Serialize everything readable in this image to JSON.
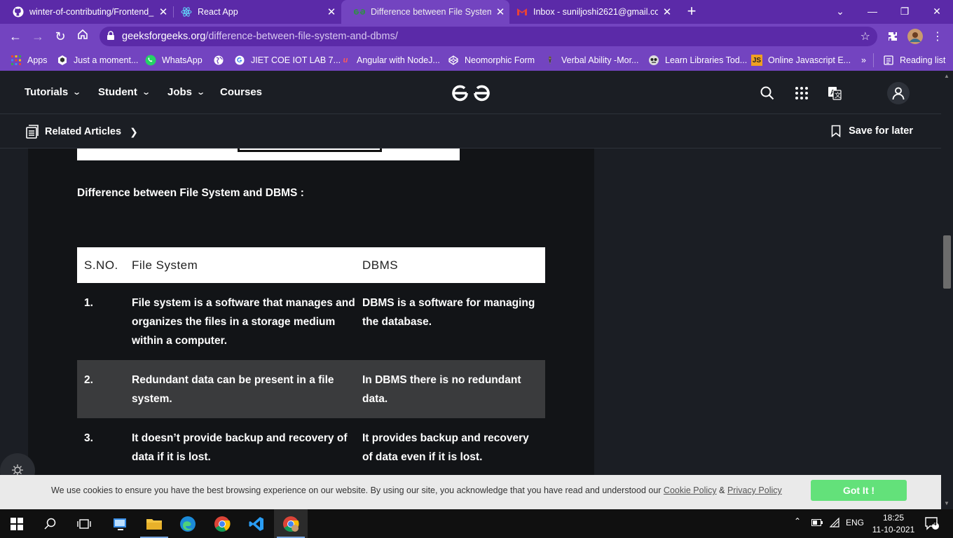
{
  "browser": {
    "tabs": [
      {
        "title": "winter-of-contributing/Frontend_",
        "icon": "github-icon"
      },
      {
        "title": "React App",
        "icon": "react-icon"
      },
      {
        "title": "Difference between File System a",
        "icon": "gfg-icon",
        "active": true
      },
      {
        "title": "Inbox - suniljoshi2621@gmail.co",
        "icon": "gmail-icon"
      }
    ],
    "url_domain": "geeksforgeeks.org",
    "url_path": "/difference-between-file-system-and-dbms/",
    "bookmarks": [
      "Apps",
      "Just a moment...",
      "WhatsApp",
      "",
      "JIET COE IOT LAB 7...",
      "Angular with NodeJ...",
      "Neomorphic Form",
      "Verbal Ability -Mor...",
      "Learn Libraries Tod...",
      "Online Javascript E..."
    ],
    "bookmarks_overflow": "»",
    "reading_list": "Reading list"
  },
  "site": {
    "nav": [
      "Tutorials",
      "Student",
      "Jobs",
      "Courses"
    ],
    "related_articles": "Related Articles",
    "save_for_later": "Save for later"
  },
  "article": {
    "heading": "Difference between File System and DBMS :",
    "table": {
      "headers": [
        "S.NO.",
        "File System",
        "DBMS"
      ],
      "rows": [
        {
          "sno": "1.",
          "fs": "File system is a software that manages and organizes the files in a storage medium within a computer.",
          "dbms": "DBMS is a software for managing the database."
        },
        {
          "sno": "2.",
          "fs": "Redundant data can be present in a file system.",
          "dbms": "In DBMS there is no redundant data."
        },
        {
          "sno": "3.",
          "fs": "It doesn’t provide backup and recovery of data if it is lost.",
          "dbms": "It provides backup and recovery of data even if it is lost."
        }
      ]
    }
  },
  "cookie": {
    "message": "We use cookies to ensure you have the best browsing experience on our website. By using our site, you acknowledge that you have read and understood our ",
    "cookie_policy": "Cookie Policy",
    "amp": " & ",
    "privacy_policy": "Privacy Policy",
    "button": "Got It !"
  },
  "taskbar": {
    "lang": "ENG",
    "time": "18:25",
    "date": "11-10-2021",
    "notifications": "4"
  },
  "colors": {
    "accent": "#7344c0",
    "tab_strip": "#5b2aa8",
    "got_it": "#63e17a"
  }
}
